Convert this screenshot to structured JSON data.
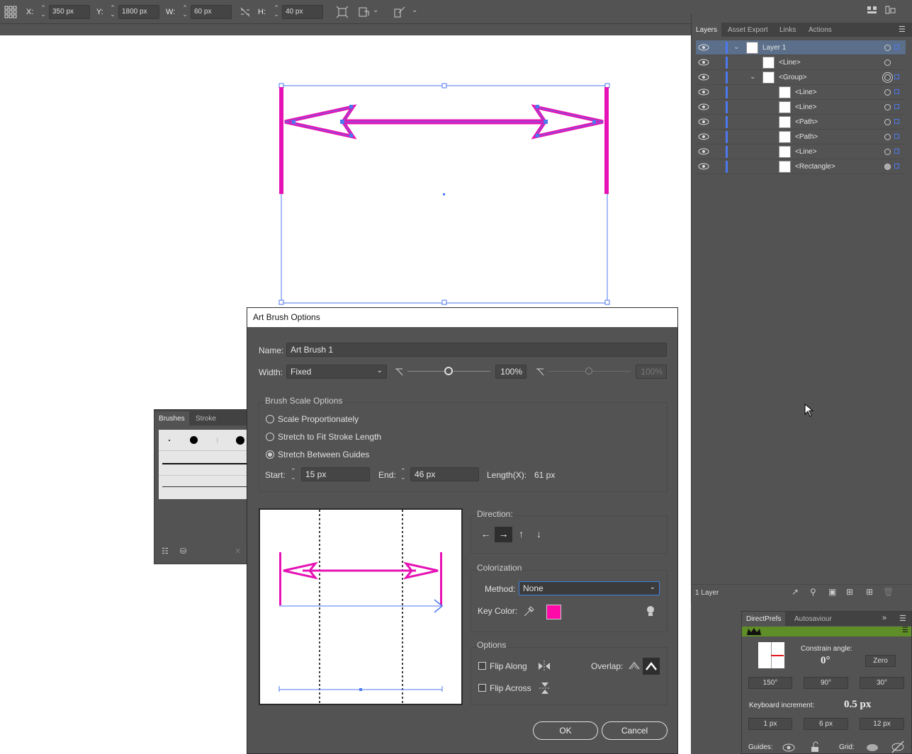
{
  "control_bar": {
    "x_label": "X:",
    "x_value": "350 px",
    "y_label": "Y:",
    "y_value": "1800 px",
    "w_label": "W:",
    "w_value": "60 px",
    "h_label": "H:",
    "h_value": "40 px"
  },
  "layers_panel": {
    "tabs": [
      "Layers",
      "Asset Export",
      "Links",
      "Actions"
    ],
    "rows": [
      {
        "name": "Layer 1"
      },
      {
        "name": "<Line>"
      },
      {
        "name": "<Group>"
      },
      {
        "name": "<Line>"
      },
      {
        "name": "<Line>"
      },
      {
        "name": "<Path>"
      },
      {
        "name": "<Path>"
      },
      {
        "name": "<Line>"
      },
      {
        "name": "<Rectangle>"
      }
    ],
    "footer_count": "1 Layer"
  },
  "brushes_panel": {
    "tabs": [
      "Brushes",
      "Stroke"
    ]
  },
  "dialog": {
    "title": "Art Brush Options",
    "name_label": "Name:",
    "name_value": "Art Brush 1",
    "width_label": "Width:",
    "width_value": "Fixed",
    "width_percent": "100%",
    "width_percent_disabled": "100%",
    "scale_group_title": "Brush Scale Options",
    "scale_options": [
      "Scale Proportionately",
      "Stretch to Fit Stroke Length",
      "Stretch Between Guides"
    ],
    "scale_selected": "Stretch Between Guides",
    "start_label": "Start:",
    "start_value": "15 px",
    "end_label": "End:",
    "end_value": "46 px",
    "length_label": "Length(X):",
    "length_value": "61 px",
    "direction_title": "Direction:",
    "colorization_title": "Colorization",
    "method_label": "Method:",
    "method_value": "None",
    "key_color_label": "Key Color:",
    "key_color": "#ff0aa8",
    "options_title": "Options",
    "flip_along_label": "Flip Along",
    "flip_across_label": "Flip Across",
    "overlap_label": "Overlap:",
    "ok_label": "OK",
    "cancel_label": "Cancel"
  },
  "direct_prefs": {
    "tabs": [
      "DirectPrefs",
      "Autosaviour"
    ],
    "constrain_label": "Constrain angle:",
    "constrain_value": "0°",
    "zero_label": "Zero",
    "angle_buttons": [
      "150°",
      "90°",
      "30°"
    ],
    "keyboard_label": "Keyboard increment:",
    "keyboard_value": "0.5 px",
    "increment_buttons": [
      "1 px",
      "6 px",
      "12 px"
    ],
    "guides_label": "Guides:",
    "grid_label": "Grid:"
  },
  "colors": {
    "accent_magenta": "#e612b4",
    "selection_blue": "#4d79f0",
    "panel_bg": "#535353"
  }
}
